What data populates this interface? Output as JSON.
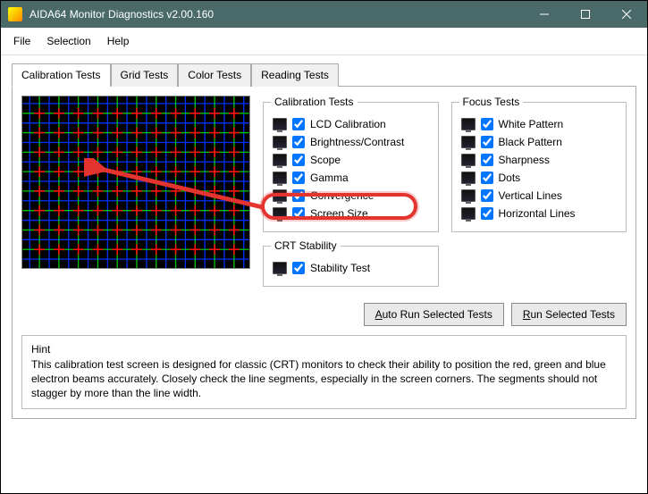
{
  "window": {
    "title": "AIDA64 Monitor Diagnostics v2.00.160"
  },
  "menu": {
    "file": "File",
    "selection": "Selection",
    "help": "Help"
  },
  "tabs": {
    "calibration": "Calibration Tests",
    "grid": "Grid Tests",
    "color": "Color Tests",
    "reading": "Reading Tests"
  },
  "groups": {
    "calibration": {
      "legend": "Calibration Tests",
      "items": {
        "lcd": "LCD Calibration",
        "brightness": "Brightness/Contrast",
        "scope": "Scope",
        "gamma": "Gamma",
        "convergence": "Convergence",
        "screensize": "Screen Size"
      }
    },
    "crt": {
      "legend": "CRT Stability",
      "items": {
        "stability": "Stability Test"
      }
    },
    "focus": {
      "legend": "Focus Tests",
      "items": {
        "white": "White Pattern",
        "black": "Black Pattern",
        "sharpness": "Sharpness",
        "dots": "Dots",
        "vertical": "Vertical Lines",
        "horizontal": "Horizontal Lines"
      }
    }
  },
  "buttons": {
    "auto_prefix": "A",
    "auto_suffix": "uto Run Selected Tests",
    "run_prefix": "R",
    "run_suffix": "un Selected Tests"
  },
  "hint": {
    "title": "Hint",
    "body": "This calibration test screen is designed for classic (CRT) monitors to check their ability to position the red, green and blue electron beams accurately. Closely check the line segments, especially in the screen corners. The segments should not stagger by more than the line width."
  }
}
